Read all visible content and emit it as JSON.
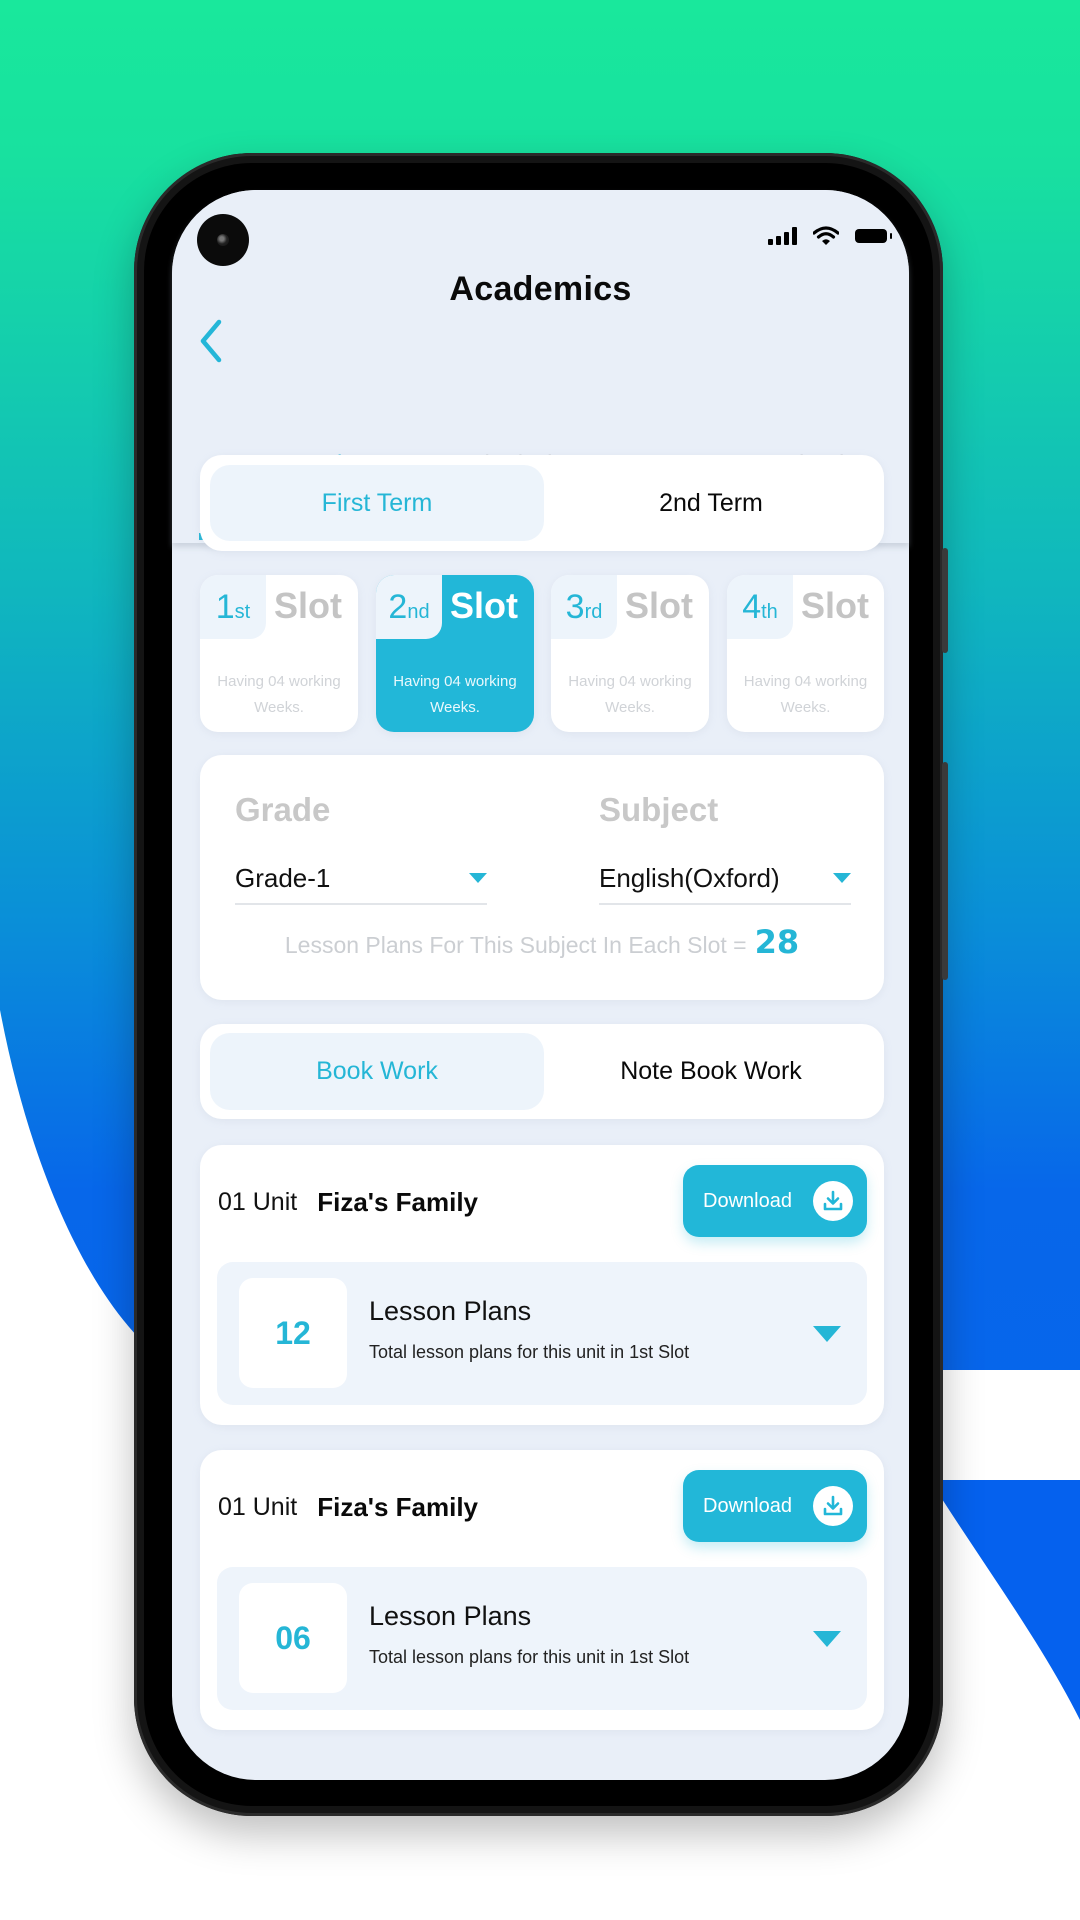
{
  "status_bar": {
    "icons": [
      "signal-icon",
      "wifi-icon",
      "battery-icon"
    ]
  },
  "header": {
    "title": "Academics",
    "back_icon": "chevron-left-icon"
  },
  "tabs": [
    {
      "label": "Lesson Plans",
      "active": true
    },
    {
      "label": "Submission Status",
      "active": false
    },
    {
      "label": "Calendar",
      "active": false
    }
  ],
  "terms": [
    {
      "label": "First Term",
      "active": true
    },
    {
      "label": "2nd Term",
      "active": false
    }
  ],
  "slots": [
    {
      "num": "1",
      "suffix": "st",
      "word": "Slot",
      "desc_line1": "Having 04 working",
      "desc_line2": "Weeks.",
      "active": false
    },
    {
      "num": "2",
      "suffix": "nd",
      "word": "Slot",
      "desc_line1": "Having 04 working",
      "desc_line2": "Weeks.",
      "active": true
    },
    {
      "num": "3",
      "suffix": "rd",
      "word": "Slot",
      "desc_line1": "Having 04 working",
      "desc_line2": "Weeks.",
      "active": false
    },
    {
      "num": "4",
      "suffix": "th",
      "word": "Slot",
      "desc_line1": "Having 04 working",
      "desc_line2": "Weeks.",
      "active": false
    }
  ],
  "filters": {
    "grade": {
      "label": "Grade",
      "value": "Grade-1"
    },
    "subject": {
      "label": "Subject",
      "value": "English(Oxford)"
    },
    "summary_text": "Lesson Plans For This Subject In Each Slot =",
    "summary_count": "28"
  },
  "work_types": [
    {
      "label": "Book Work",
      "active": true
    },
    {
      "label": "Note Book Work",
      "active": false
    }
  ],
  "units": [
    {
      "prefix": "01 Unit",
      "name": "Fiza's Family",
      "download_label": "Download",
      "count": "12",
      "lp_title": "Lesson Plans",
      "lp_subtitle": "Total lesson plans for this unit in 1st Slot"
    },
    {
      "prefix": "01 Unit",
      "name": "Fiza's Family",
      "download_label": "Download",
      "count": "06",
      "lp_title": "Lesson Plans",
      "lp_subtitle": "Total lesson plans for this unit in 1st Slot"
    }
  ],
  "colors": {
    "accent": "#22b7d8",
    "active_bg": "#edf4fb",
    "screen_bg": "#e9eff8",
    "bg_gradient_top": "#19e89c",
    "bg_gradient_bottom": "#0561ee"
  }
}
